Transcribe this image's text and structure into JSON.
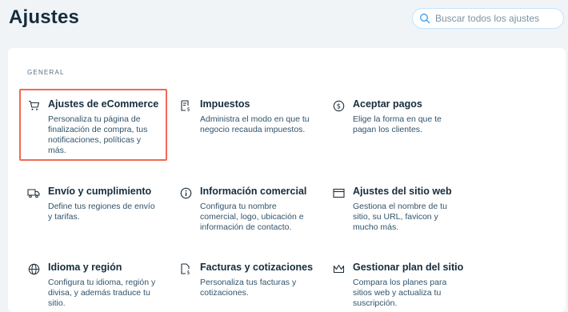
{
  "page": {
    "title": "Ajustes"
  },
  "search": {
    "placeholder": "Buscar todos los ajustes",
    "icon": "search-icon"
  },
  "section": {
    "label": "GENERAL"
  },
  "items": [
    {
      "name": "Ajustes de eCommerce",
      "desc": "Personaliza tu página de finalización de compra, tus notificaciones, políticas y más.",
      "icon": "cart-icon",
      "highlighted": true
    },
    {
      "name": "Impuestos",
      "desc": "Administra el modo en que tu negocio recauda impuestos.",
      "icon": "tax-receipt-icon"
    },
    {
      "name": "Aceptar pagos",
      "desc": "Elige la forma en que te pagan los clientes.",
      "icon": "dollar-circle-icon"
    },
    {
      "name": "Envío y cumplimiento",
      "desc": "Define tus regiones de envío y tarifas.",
      "icon": "truck-icon"
    },
    {
      "name": "Información comercial",
      "desc": "Configura tu nombre comercial, logo, ubicación e información de contacto.",
      "icon": "info-icon"
    },
    {
      "name": "Ajustes del sitio web",
      "desc": "Gestiona el nombre de tu sitio, su URL, favicon y mucho más.",
      "icon": "browser-window-icon"
    },
    {
      "name": "Idioma y región",
      "desc": "Configura tu idioma, región y divisa, y además traduce tu sitio.",
      "icon": "globe-icon"
    },
    {
      "name": "Facturas y cotizaciones",
      "desc": "Personaliza tus facturas y cotizaciones.",
      "icon": "invoice-icon"
    },
    {
      "name": "Gestionar plan del sitio",
      "desc": "Compara los planes para sitios web y actualiza tu suscripción.",
      "icon": "crown-icon"
    }
  ],
  "colors": {
    "background": "#f0f4f7",
    "highlight_border": "#ef6a54",
    "search_border": "#c1e4fe",
    "heading": "#162d3d"
  }
}
